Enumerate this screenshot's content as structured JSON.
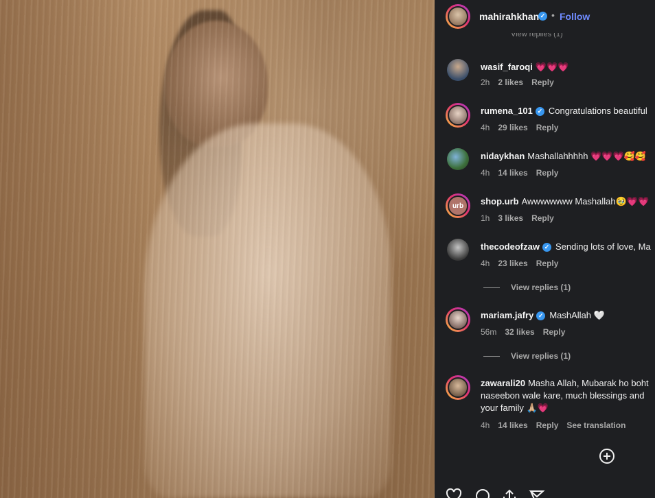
{
  "post": {
    "author": "mahirahkhan",
    "follow_label": "Follow",
    "separator": "•"
  },
  "faded_text": "View replies (1)",
  "comments": [
    {
      "user": "wasif_faroqi",
      "verified": false,
      "text": "💗💗💗",
      "time": "2h",
      "likes": "2 likes",
      "reply": "Reply"
    },
    {
      "user": "rumena_101",
      "verified": true,
      "text": "Congratulations beautiful",
      "time": "4h",
      "likes": "29 likes",
      "reply": "Reply"
    },
    {
      "user": "nidaykhan",
      "verified": false,
      "text": "Mashallahhhhh 💗💗💗🥰🥰",
      "time": "4h",
      "likes": "14 likes",
      "reply": "Reply"
    },
    {
      "user": "shop.urb",
      "verified": false,
      "text": "Awwwwwww Mashallah🥹💗💗",
      "time": "1h",
      "likes": "3 likes",
      "reply": "Reply"
    },
    {
      "user": "thecodeofzaw",
      "verified": true,
      "text": "Sending lots of love, Ma",
      "time": "4h",
      "likes": "23 likes",
      "reply": "Reply",
      "view_replies": "View replies (1)"
    },
    {
      "user": "mariam.jafry",
      "verified": true,
      "text": "MashAllah 🤍",
      "time": "56m",
      "likes": "32 likes",
      "reply": "Reply",
      "view_replies": "View replies (1)"
    },
    {
      "user": "zawarali20",
      "verified": false,
      "text": "Masha Allah, Mubarak ho boht naseebon wale kare, much blessings and your family 🙏🏼💗",
      "time": "4h",
      "likes": "14 likes",
      "reply": "Reply",
      "see_translation": "See translation"
    }
  ],
  "icons": {
    "verified": "verified-badge-icon",
    "load_more": "plus-circle-icon",
    "like": "heart-icon",
    "comment": "comment-icon",
    "share": "share-icon",
    "save": "bookmark-icon"
  },
  "colors": {
    "panel_bg": "#1e1f22",
    "follow": "#6f8bff",
    "verified": "#3897f0"
  }
}
